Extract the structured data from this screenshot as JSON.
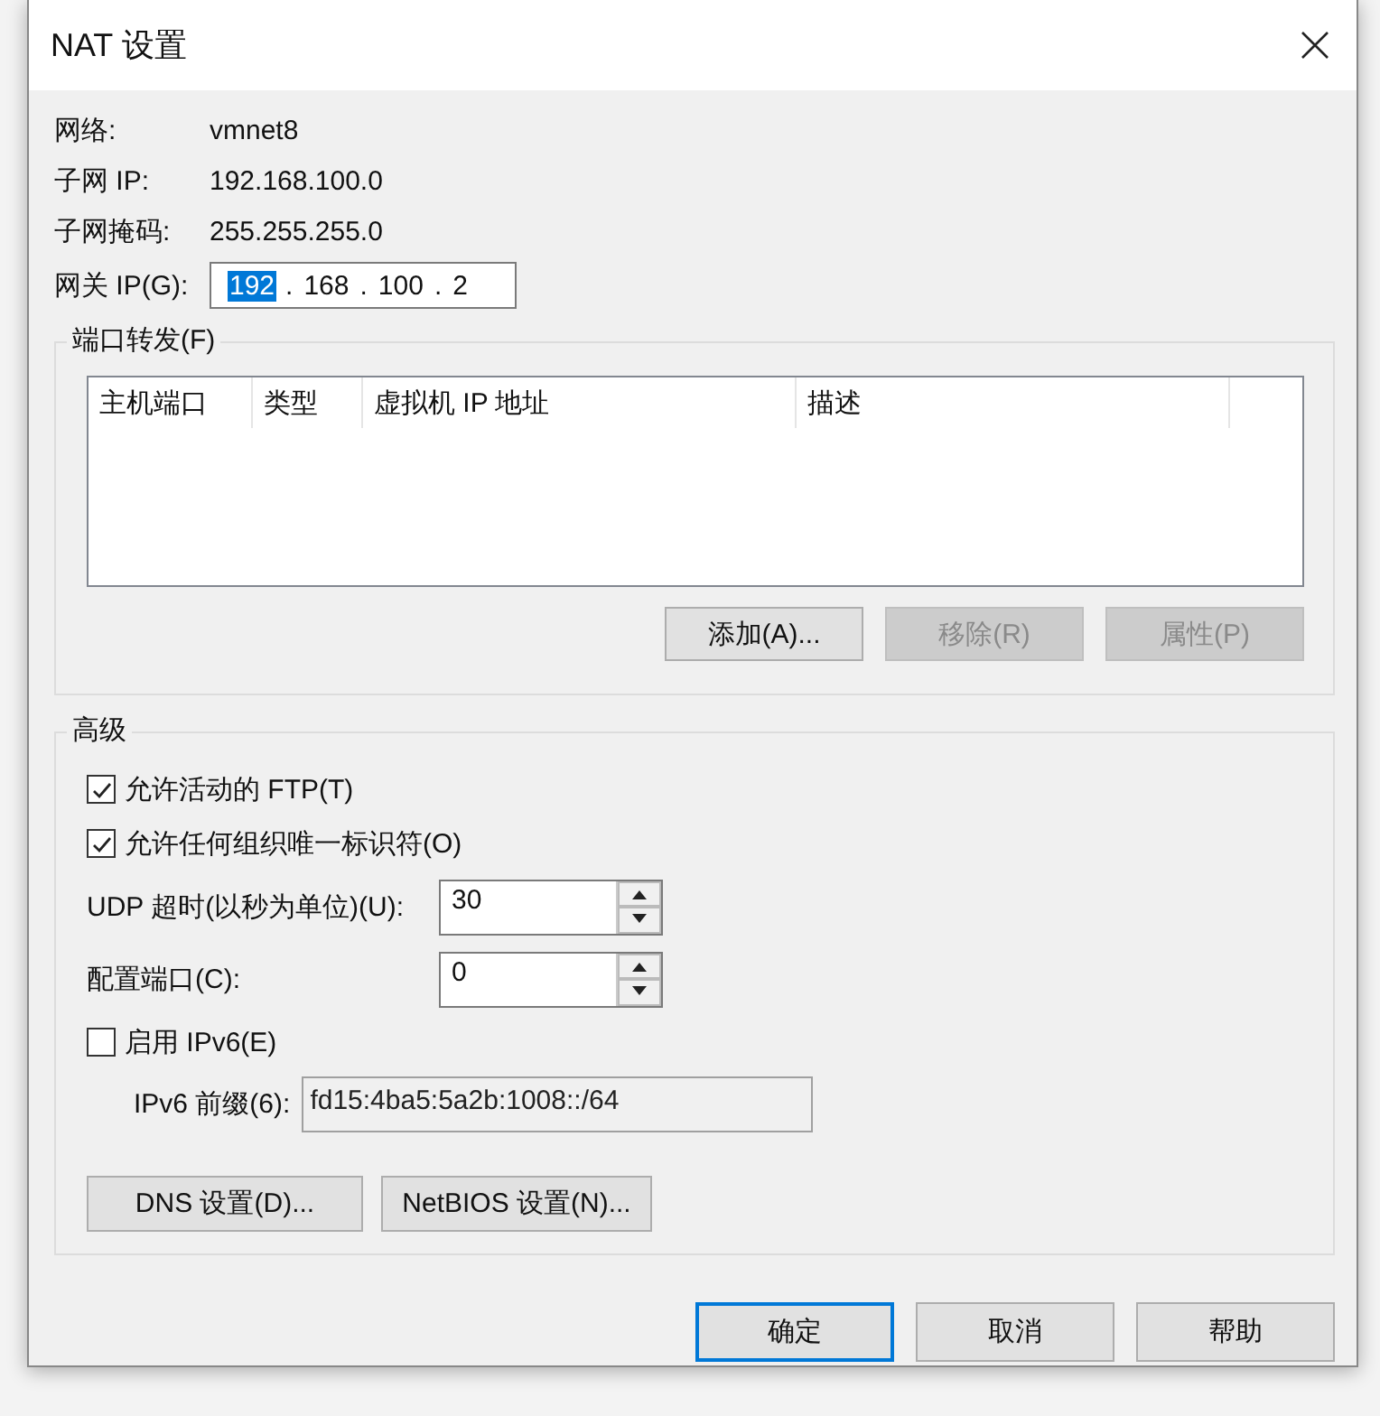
{
  "window": {
    "title": "NAT 设置"
  },
  "info": [
    {
      "label": "网络:",
      "value": "vmnet8"
    },
    {
      "label": "子网 IP:",
      "value": "192.168.100.0"
    },
    {
      "label": "子网掩码:",
      "value": "255.255.255.0"
    }
  ],
  "gateway": {
    "label": "网关 IP(G):",
    "separator": ".",
    "octets": [
      {
        "value": "192",
        "selected": true
      },
      {
        "value": "168",
        "selected": false
      },
      {
        "value": "100",
        "selected": false
      },
      {
        "value": "2",
        "selected": false
      }
    ]
  },
  "port_forwarding": {
    "title": "端口转发(F)",
    "columns": [
      "主机端口",
      "类型",
      "虚拟机 IP 地址",
      "描述"
    ],
    "buttons": [
      {
        "label": "添加(A)...",
        "disabled": false
      },
      {
        "label": "移除(R)",
        "disabled": true
      },
      {
        "label": "属性(P)",
        "disabled": true
      }
    ]
  },
  "advanced": {
    "title": "高级",
    "checkboxes": [
      {
        "label": "允许活动的 FTP(T)",
        "checked": true
      },
      {
        "label": "允许任何组织唯一标识符(O)",
        "checked": true
      }
    ],
    "spinners": [
      {
        "label": "UDP 超时(以秒为单位)(U):",
        "value": "30"
      },
      {
        "label": "配置端口(C):",
        "value": "0"
      }
    ],
    "ipv6": {
      "label": "启用 IPv6(E)",
      "checked": false
    },
    "prefix": {
      "label": "IPv6 前缀(6):",
      "value": "fd15:4ba5:5a2b:1008::/64"
    },
    "buttons": [
      "DNS 设置(D)...",
      "NetBIOS 设置(N)..."
    ]
  },
  "footer_buttons": [
    {
      "label": "确定",
      "default": true
    },
    {
      "label": "取消",
      "default": false
    },
    {
      "label": "帮助",
      "default": false
    }
  ]
}
